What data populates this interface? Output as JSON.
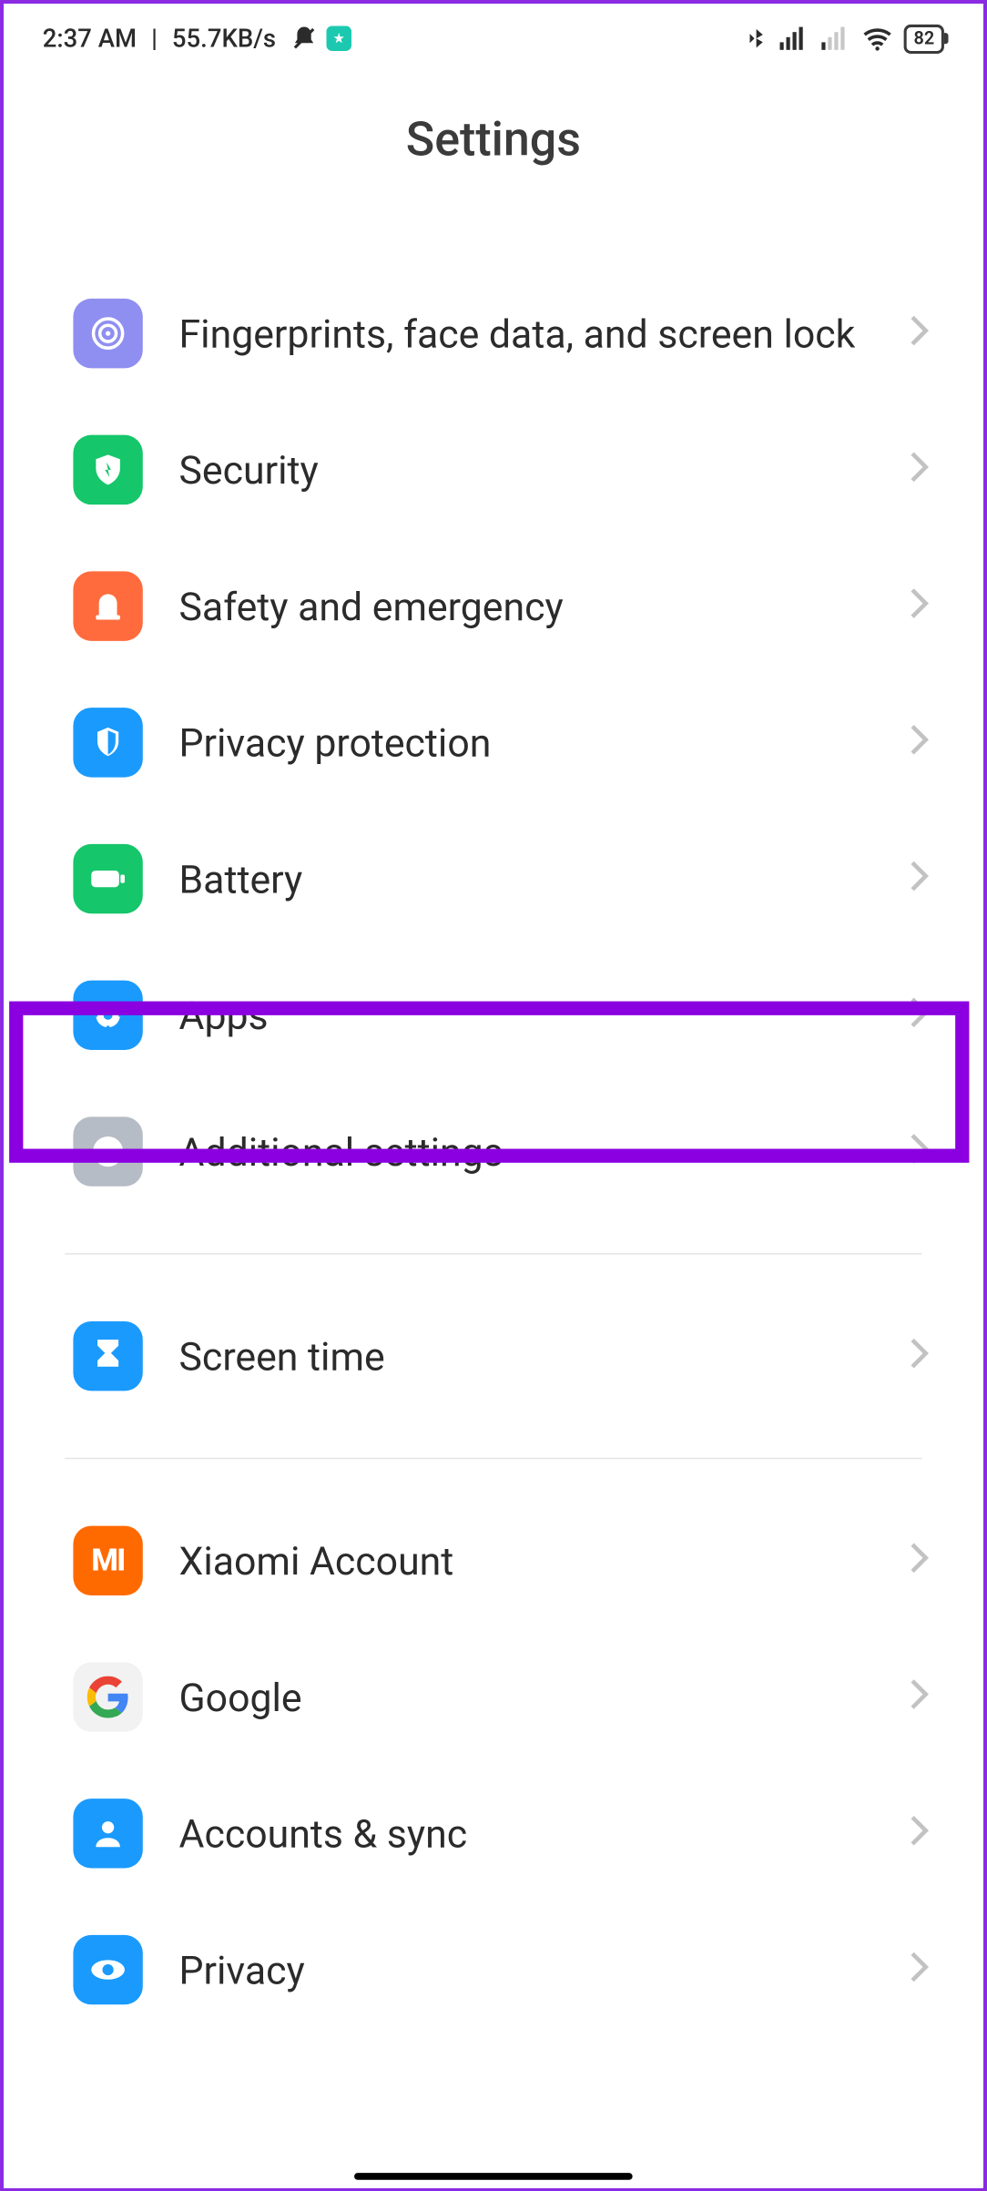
{
  "status": {
    "time": "2:37 AM",
    "speed": "55.7KB/s",
    "battery": "82"
  },
  "header": {
    "title": "Settings"
  },
  "rows": [
    {
      "id": "fingerprints",
      "label": "Fingerprints, face data, and screen lock"
    },
    {
      "id": "security",
      "label": "Security"
    },
    {
      "id": "safety",
      "label": "Safety and emergency"
    },
    {
      "id": "privacyprot",
      "label": "Privacy protection"
    },
    {
      "id": "battery",
      "label": "Battery"
    },
    {
      "id": "apps",
      "label": "Apps"
    },
    {
      "id": "additional",
      "label": "Additional settings"
    },
    {
      "id": "screentime",
      "label": "Screen time"
    },
    {
      "id": "xiaomi",
      "label": "Xiaomi Account"
    },
    {
      "id": "google",
      "label": "Google"
    },
    {
      "id": "accounts",
      "label": "Accounts & sync"
    },
    {
      "id": "privacy",
      "label": "Privacy"
    }
  ],
  "highlighted_row": "apps"
}
